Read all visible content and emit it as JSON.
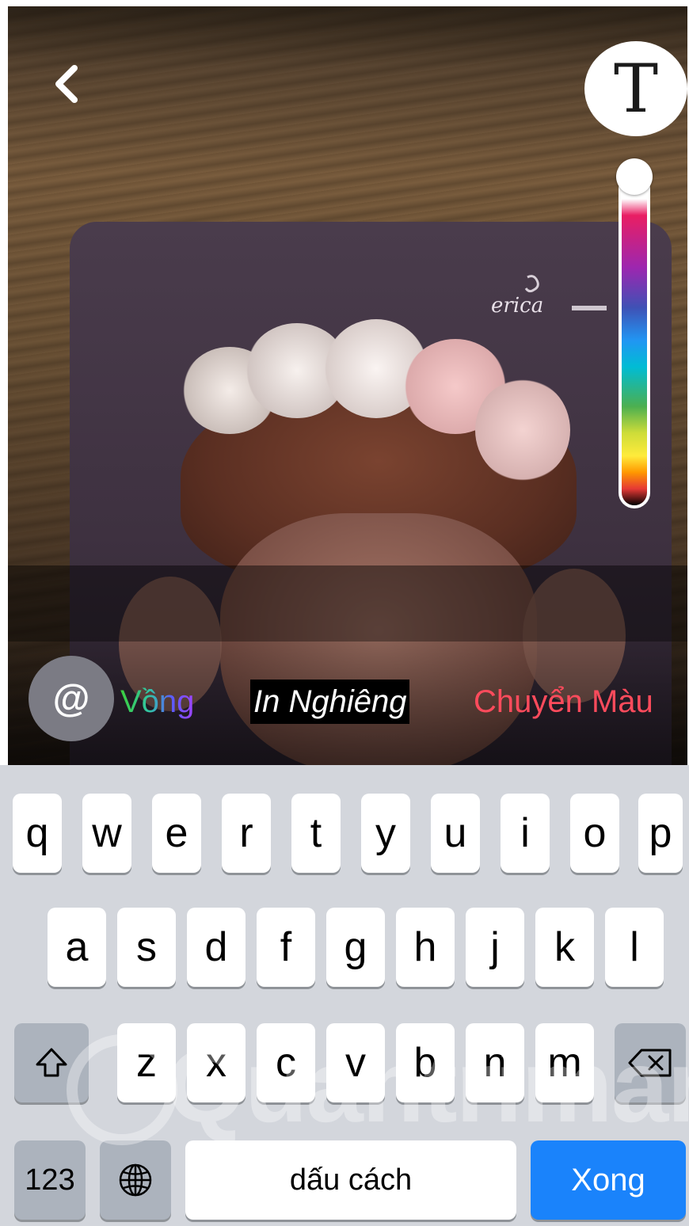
{
  "top_bar": {
    "back_icon": "chevron-left-icon",
    "text_style_glyph": "T"
  },
  "photo": {
    "card_logo_text": "erica"
  },
  "text_styles": {
    "mention_symbol": "@",
    "options": [
      "Vồng",
      "In Nghiêng",
      "Chuyển Màu"
    ]
  },
  "keyboard": {
    "row1": [
      "q",
      "w",
      "e",
      "r",
      "t",
      "y",
      "u",
      "i",
      "o",
      "p"
    ],
    "row2": [
      "a",
      "s",
      "d",
      "f",
      "g",
      "h",
      "j",
      "k",
      "l"
    ],
    "row3": [
      "z",
      "x",
      "c",
      "v",
      "b",
      "n",
      "m"
    ],
    "numbers_key": "123",
    "space_key": "dấu cách",
    "done_key": "Xong",
    "shift_icon": "shift-icon",
    "delete_icon": "backspace-icon",
    "globe_icon": "globe-icon"
  },
  "watermark": "Quantrimang",
  "colors": {
    "done_key": "#1a83fb",
    "keyboard_bg": "#d3d6dc",
    "gradient_option": "#ff4b5c"
  }
}
